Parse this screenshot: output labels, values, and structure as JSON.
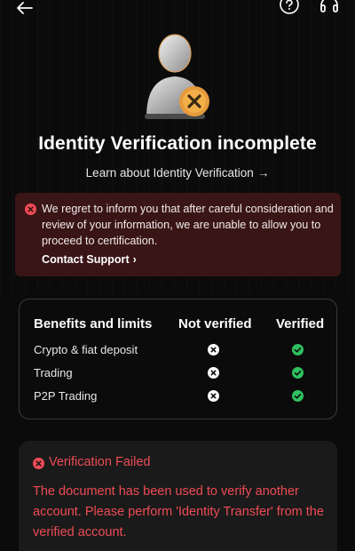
{
  "colors": {
    "background": "#0b0b0b",
    "danger": "#ee4b55",
    "success": "#2fbf5f",
    "alert_bg": "#3a1516",
    "card_bg": "#1a1a1a"
  },
  "topbar": {
    "back_icon": "arrow-left-icon",
    "help_icon": "help-circle-icon",
    "support_icon": "headset-icon"
  },
  "status": {
    "title": "Identity Verification incomplete",
    "learn_more": "Learn about Identity Verification",
    "learn_more_arrow": "→"
  },
  "alert": {
    "message": "We regret to inform you that after careful consideration and review of your information, we are unable to allow you to proceed to certification.",
    "link": "Contact Support",
    "link_chevron": "›"
  },
  "limits": {
    "headers": [
      "Benefits and limits",
      "Not verified",
      "Verified"
    ],
    "rows": [
      {
        "label": "Crypto & fiat deposit",
        "not_verified": false,
        "verified": true
      },
      {
        "label": "Trading",
        "not_verified": false,
        "verified": true
      },
      {
        "label": "P2P Trading",
        "not_verified": false,
        "verified": true
      }
    ]
  },
  "failure": {
    "title": "Verification Failed",
    "message": "The document has been used to verify another account. Please perform 'Identity Transfer' from the verified account."
  }
}
